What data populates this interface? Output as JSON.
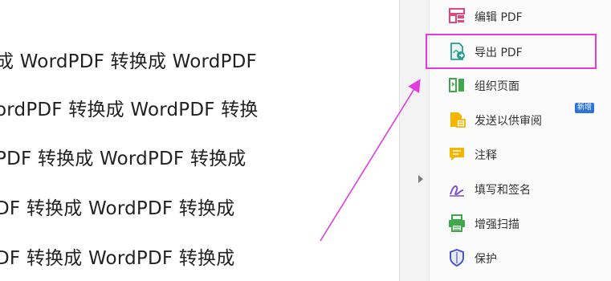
{
  "document": {
    "lines": [
      "成 WordPDF 转换成 WordPDF",
      "ordPDF 转换成 WordPDF 转换",
      "PDF 转换成 WordPDF 转换成",
      "DF 转换成 WordPDF 转换成",
      "DF 转换成 WordPDF 转换成"
    ]
  },
  "tools_panel": {
    "items": [
      {
        "label": "编辑 PDF",
        "icon": "edit-pdf-icon"
      },
      {
        "label": "导出 PDF",
        "icon": "export-pdf-icon"
      },
      {
        "label": "组织页面",
        "icon": "organize-pages-icon"
      },
      {
        "label": "发送以供审阅",
        "icon": "send-for-review-icon"
      },
      {
        "label": "注释",
        "icon": "comment-icon"
      },
      {
        "label": "填写和签名",
        "icon": "fill-sign-icon"
      },
      {
        "label": "增强扫描",
        "icon": "enhance-scan-icon"
      },
      {
        "label": "保护",
        "icon": "protect-icon"
      }
    ],
    "new_badge": "新增"
  },
  "colors": {
    "highlight": "#e23be0",
    "arrow": "#e23be0",
    "badge": "#2d73d8"
  }
}
